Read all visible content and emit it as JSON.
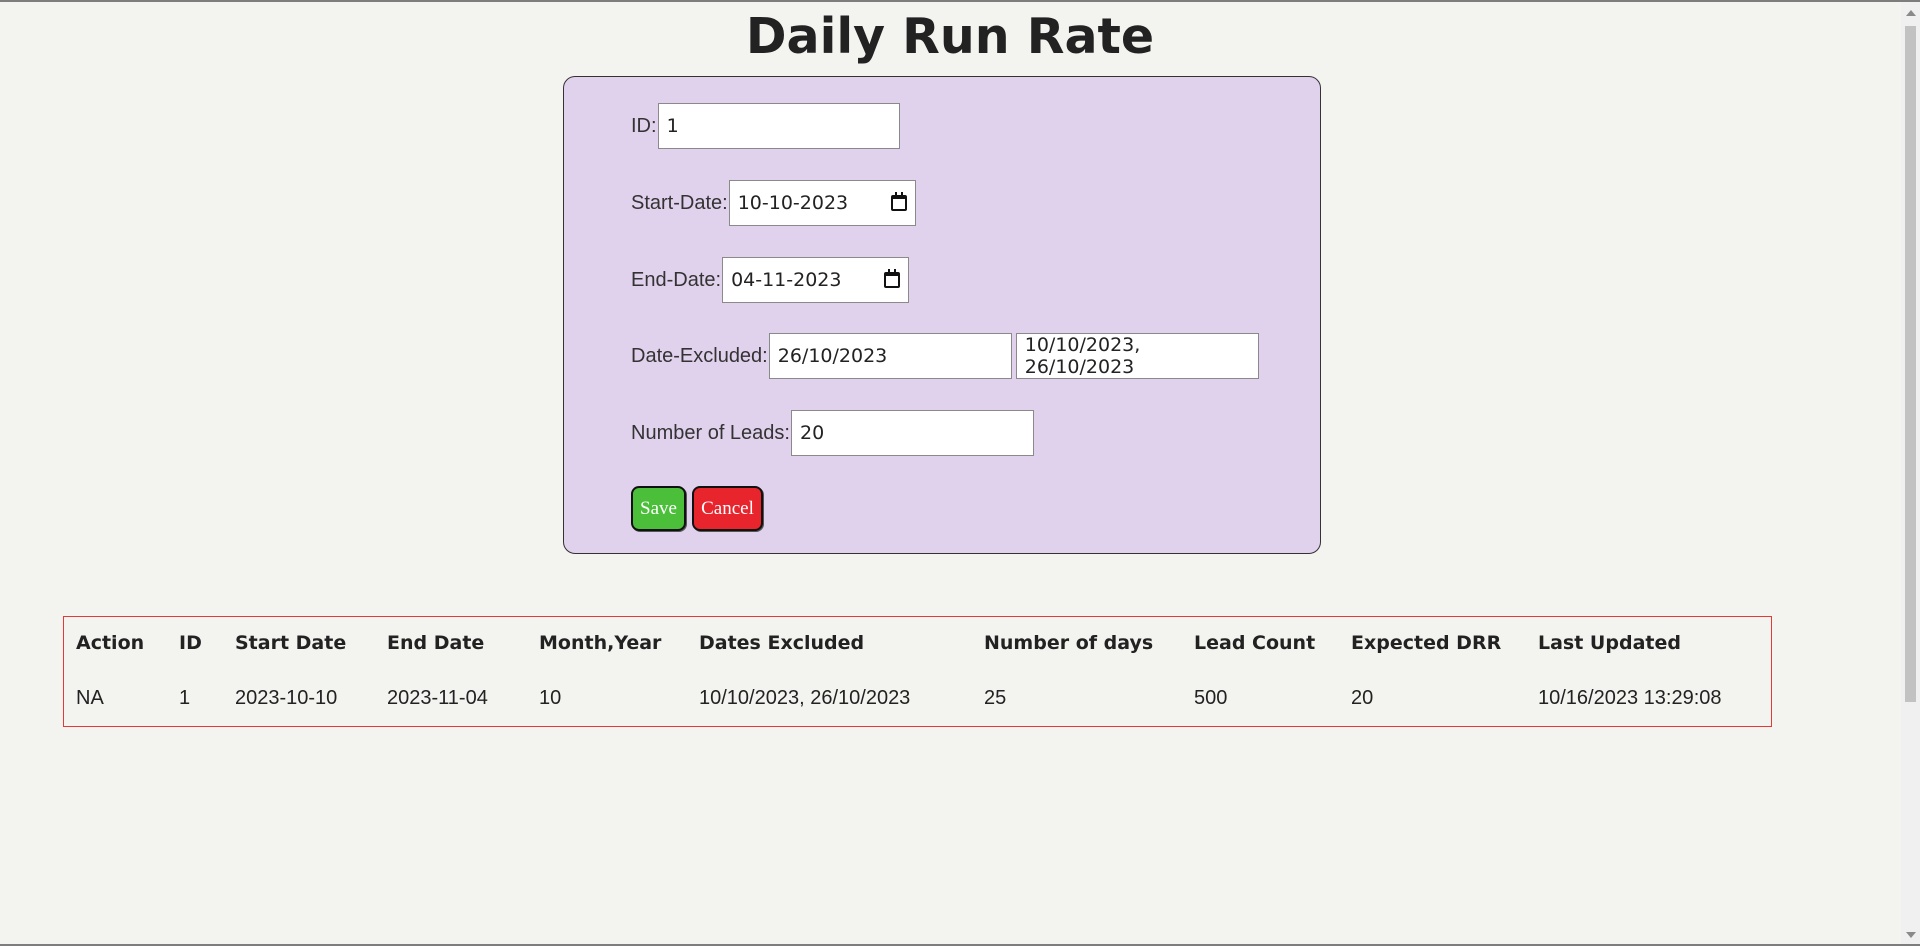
{
  "page": {
    "title": "Daily Run Rate"
  },
  "form": {
    "id_label": "ID:",
    "id_value": "1",
    "start_date_label": "Start-Date:",
    "start_date_value": "10-10-2023",
    "end_date_label": "End-Date:",
    "end_date_value": "04-11-2023",
    "date_excluded_label": "Date-Excluded:",
    "date_excluded_value": "26/10/2023",
    "date_excluded_list": "10/10/2023, 26/10/2023",
    "leads_label": "Number of Leads:",
    "leads_value": "20",
    "save_label": "Save",
    "cancel_label": "Cancel"
  },
  "table": {
    "headers": [
      "Action",
      "ID",
      "Start Date",
      "End Date",
      "Month,Year",
      "Dates Excluded",
      "Number of days",
      "Lead Count",
      "Expected DRR",
      "Last Updated"
    ],
    "rows": [
      [
        "NA",
        "1",
        "2023-10-10",
        "2023-11-04",
        "10",
        "10/10/2023, 26/10/2023",
        "25",
        "500",
        "20",
        "10/16/2023 13:29:08"
      ]
    ]
  },
  "colors": {
    "form_background": "#e0d1ec",
    "save_button": "#4bbf3a",
    "cancel_button": "#e8242c",
    "table_border": "#e53935"
  }
}
